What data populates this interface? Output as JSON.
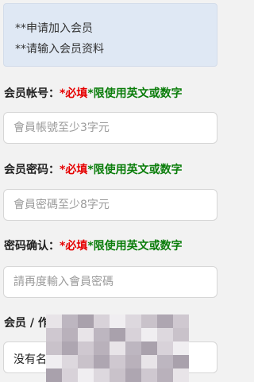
{
  "notice": {
    "line1": "**申请加入会员",
    "line2": "**请输入会员资料"
  },
  "account": {
    "label": "会员帐号：",
    "required": "*必填",
    "hint": "*限使用英文或数字",
    "placeholder": "會員帳號至少3字元",
    "value": ""
  },
  "password": {
    "label": "会员密码：",
    "required": "*必填",
    "hint": "*限使用英文或数字",
    "placeholder": "會員密碼至少8字元",
    "value": ""
  },
  "confirm": {
    "label": "密码确认：",
    "required": "*必填",
    "hint": "*限使用英文或数字",
    "placeholder": "請再度輸入會員密碼",
    "value": ""
  },
  "nickname": {
    "label": "会员 / 作",
    "selected_text": "没有名"
  },
  "colors": {
    "notice_bg": "#dfe8f4",
    "required": "#e60000",
    "hint": "#0a7d0a"
  }
}
